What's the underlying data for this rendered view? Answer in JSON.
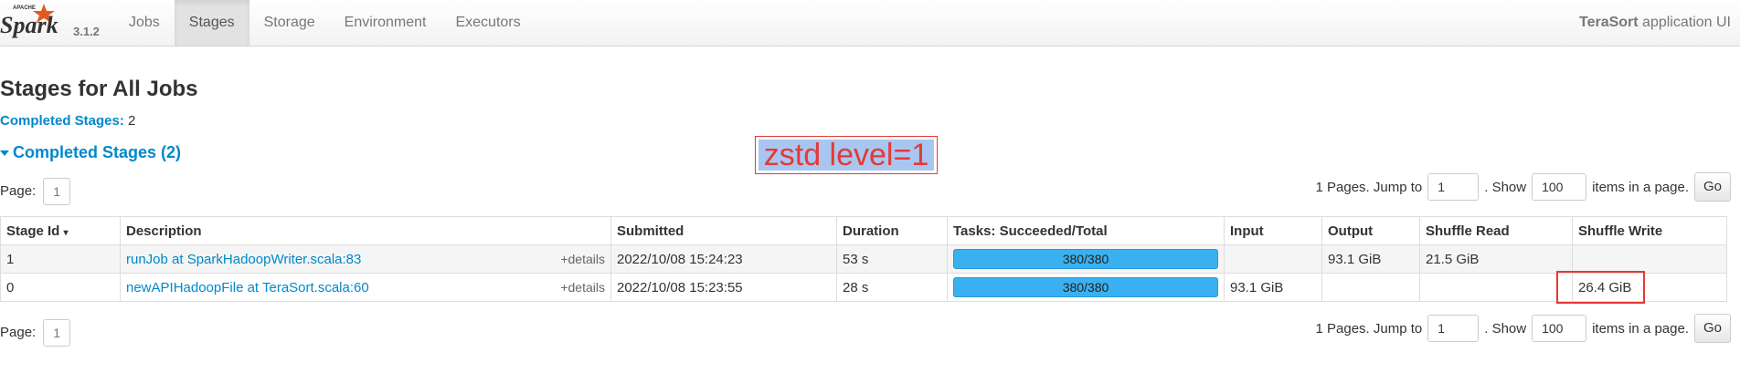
{
  "nav": {
    "version": "3.1.2",
    "tabs": [
      {
        "label": "Jobs"
      },
      {
        "label": "Stages"
      },
      {
        "label": "Storage"
      },
      {
        "label": "Environment"
      },
      {
        "label": "Executors"
      }
    ],
    "app_name": "TeraSort",
    "app_suffix": " application UI"
  },
  "page": {
    "title": "Stages for All Jobs",
    "summary_label": "Completed Stages:",
    "summary_value": "2",
    "section_title": "Completed Stages (2)"
  },
  "annotation": {
    "text": "zstd level=1",
    "color": "#e53935"
  },
  "pager": {
    "page_label": "Page:",
    "page_number": "1",
    "pages_text": "1 Pages. Jump to",
    "jump_value": "1",
    "show_text": ". Show",
    "show_value": "100",
    "items_text": "items in a page.",
    "go_label": "Go"
  },
  "table": {
    "headers": [
      "Stage Id",
      "Description",
      "Submitted",
      "Duration",
      "Tasks: Succeeded/Total",
      "Input",
      "Output",
      "Shuffle Read",
      "Shuffle Write"
    ],
    "sort_indicator": "▾",
    "details_label": "+details",
    "rows": [
      {
        "id": "1",
        "description": "runJob at SparkHadoopWriter.scala:83",
        "submitted": "2022/10/08 15:24:23",
        "duration": "53 s",
        "tasks": "380/380",
        "tasks_fraction": 1.0,
        "input": "",
        "output": "93.1 GiB",
        "shuffle_read": "21.5 GiB",
        "shuffle_write": ""
      },
      {
        "id": "0",
        "description": "newAPIHadoopFile at TeraSort.scala:60",
        "submitted": "2022/10/08 15:23:55",
        "duration": "28 s",
        "tasks": "380/380",
        "tasks_fraction": 1.0,
        "input": "93.1 GiB",
        "output": "",
        "shuffle_read": "",
        "shuffle_write": "26.4 GiB"
      }
    ]
  },
  "colors": {
    "link": "#0088cc",
    "progress": "#39b1f0",
    "highlight": "#e53935"
  }
}
